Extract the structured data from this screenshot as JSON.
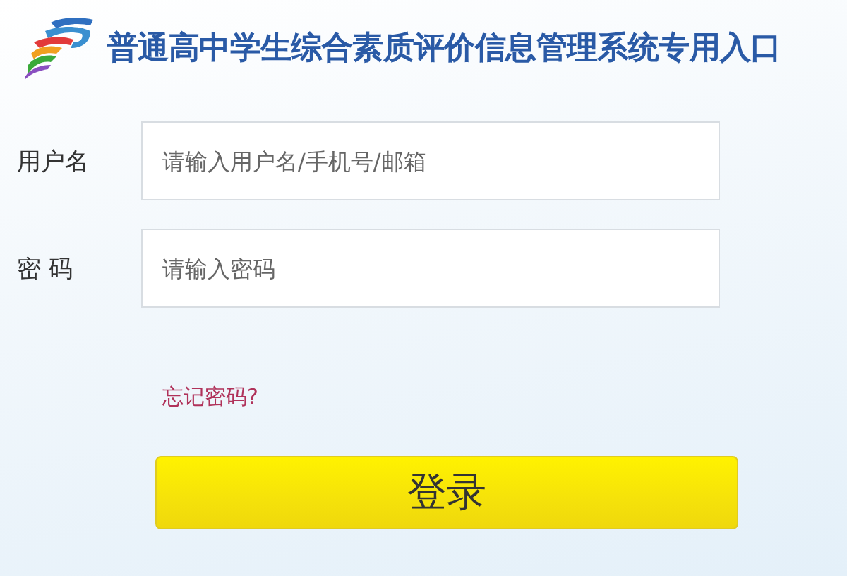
{
  "header": {
    "title": "普通高中学生综合素质评价信息管理系统专用入口"
  },
  "fields": [
    {
      "label": "用户名",
      "placeholder": "请输入用户名/手机号/邮箱"
    },
    {
      "label": "密 码",
      "placeholder": "请输入密码"
    }
  ],
  "forgot_link": "忘记密码?",
  "login_button": "登录"
}
